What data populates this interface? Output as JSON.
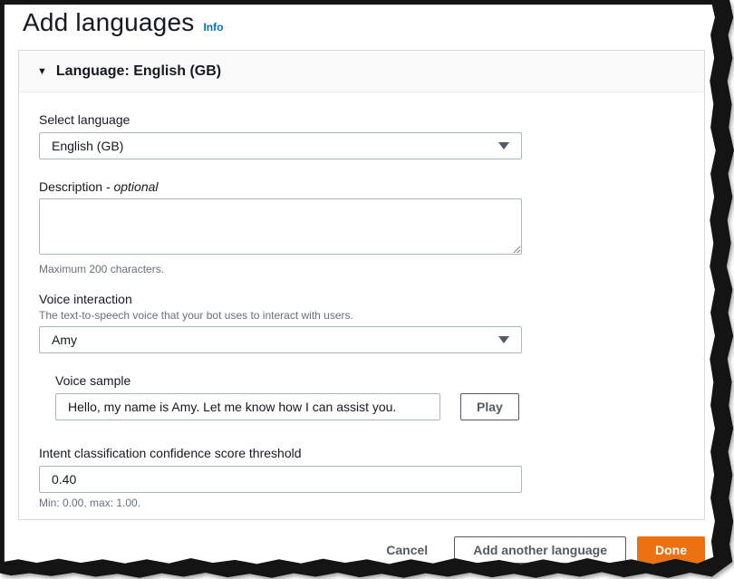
{
  "page": {
    "title": "Add languages",
    "info_link": "Info"
  },
  "icons": {
    "collapse_triangle": "▼",
    "dropdown_caret": "caret-down-icon"
  },
  "panel": {
    "header": "Language: English (GB)"
  },
  "fields": {
    "select_language": {
      "label": "Select language",
      "value": "English (GB)"
    },
    "description": {
      "label": "Description ",
      "optional_suffix": "- optional",
      "value": "",
      "hint": "Maximum 200 characters."
    },
    "voice_interaction": {
      "label": "Voice interaction",
      "description": "The text-to-speech voice that your bot uses to interact with users.",
      "value": "Amy"
    },
    "voice_sample": {
      "label": "Voice sample",
      "value": "Hello, my name is Amy. Let me know how I can assist you.",
      "play_label": "Play"
    },
    "confidence_threshold": {
      "label": "Intent classification confidence score threshold",
      "value": "0.40",
      "hint": "Min: 0.00, max: 1.00."
    }
  },
  "footer": {
    "cancel_label": "Cancel",
    "add_another_label": "Add another language",
    "done_label": "Done"
  },
  "colors": {
    "accent_orange": "#ec7211",
    "link_blue": "#0073bb",
    "text_dark": "#16191f",
    "text_secondary": "#687078",
    "input_border": "#aab7b8",
    "panel_border": "#d5dbdb",
    "button_border": "#545b64"
  }
}
